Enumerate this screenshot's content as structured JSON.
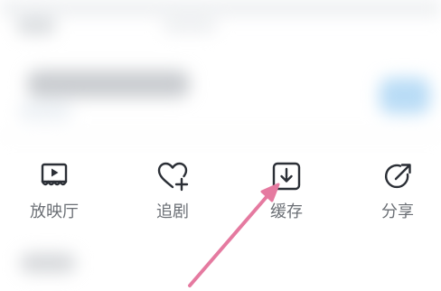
{
  "actions": [
    {
      "id": "theater",
      "label": "放映厅",
      "icon": "theater-icon"
    },
    {
      "id": "follow",
      "label": "追剧",
      "icon": "heart-plus-icon"
    },
    {
      "id": "download",
      "label": "缓存",
      "icon": "download-icon"
    },
    {
      "id": "share",
      "label": "分享",
      "icon": "share-icon"
    }
  ],
  "colors": {
    "icon": "#2b2f36",
    "label": "#6b6f75",
    "annotation": "#e57aa0"
  }
}
